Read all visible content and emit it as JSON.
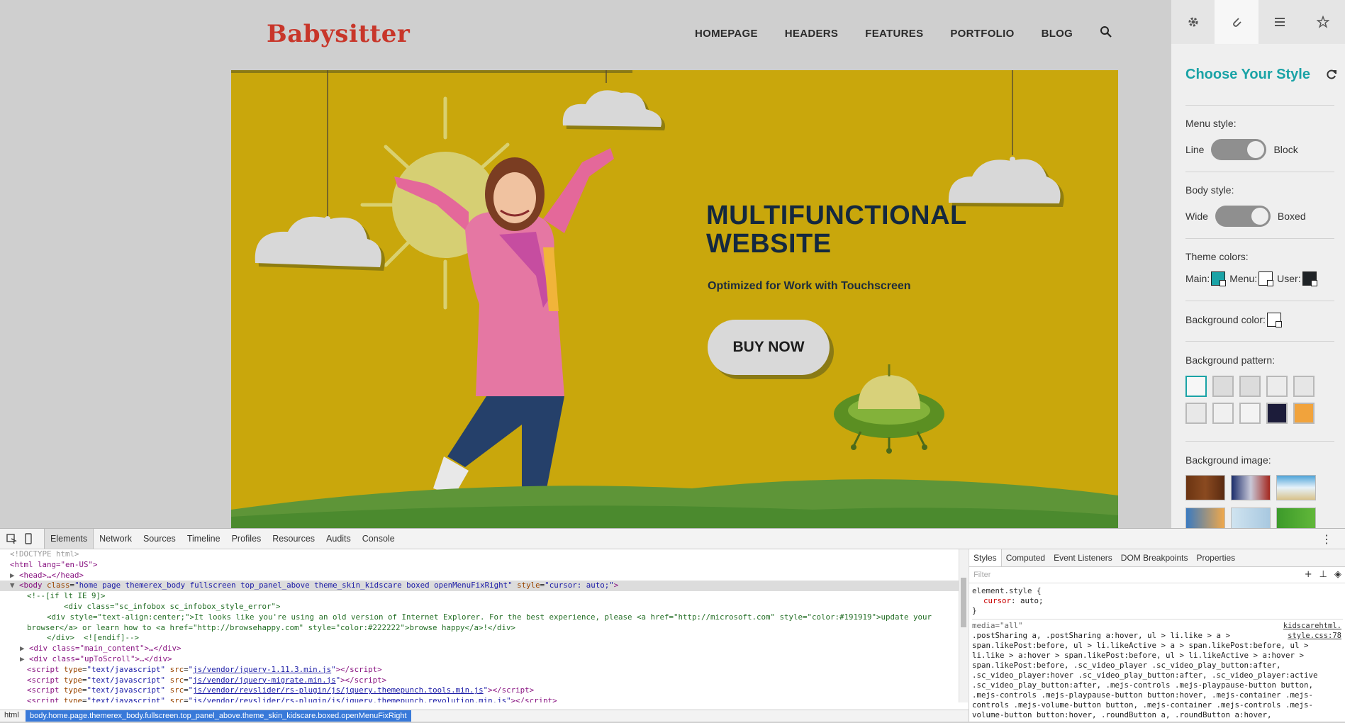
{
  "site": {
    "logo": "Babysitter",
    "nav": [
      "HOMEPAGE",
      "HEADERS",
      "FEATURES",
      "PORTFOLIO",
      "BLOG"
    ],
    "hero": {
      "title": "MULTIFUNCTIONAL WEBSITE",
      "subtitle": "Optimized for Work with Touchscreen",
      "button": "BUY NOW"
    }
  },
  "panel": {
    "title": "Choose Your Style",
    "menu_style": {
      "label": "Menu style:",
      "left": "Line",
      "right": "Block"
    },
    "body_style": {
      "label": "Body style:",
      "left": "Wide",
      "right": "Boxed"
    },
    "theme_colors": {
      "label": "Theme colors:",
      "main": "Main:",
      "menu": "Menu:",
      "user": "User:"
    },
    "background_color": "Background color:",
    "background_pattern": "Background pattern:",
    "background_image": "Background image:",
    "colors": {
      "main": "#1aa3a6",
      "menu": "#ffffff",
      "user": "#1f2326",
      "background": "#ffffff"
    }
  },
  "devtools": {
    "tabs": [
      "Elements",
      "Network",
      "Sources",
      "Timeline",
      "Profiles",
      "Resources",
      "Audits",
      "Console"
    ],
    "dom": {
      "doctype": "<!DOCTYPE html>",
      "html_open": "<html lang=\"en-US\">",
      "head": "<head>…</head>",
      "body_class": "home page themerex_body fullscreen top_panel_above theme_skin_kidscare boxed openMenuFixRight",
      "body_style": "cursor: auto;",
      "cond_open": "<!--[if lt IE 9]>",
      "div_infobox": "<div class=\"sc_infobox sc_infobox_style_error\">",
      "div_text_1": "<div style=\"text-align:center;\">It looks like you're using an old version of Internet Explorer. For the best experience, please <a href=\"http://microsoft.com\" style=\"color:#191919\">update your",
      "div_text_2": "browser</a> or learn how to <a href=\"http://browsehappy.com\" style=\"color:#222222\">browse happy</a>!</div>",
      "cond_close": "</div>  <![endif]-->",
      "main_content": "<div class=\"main_content\">…</div>",
      "up_to_scroll": "<div class=\"upToScroll\">…</div>",
      "scripts": [
        "js/vendor/jquery-1.11.3.min.js",
        "js/vendor/jquery-migrate.min.js",
        "js/vendor/revslider/rs-plugin/js/jquery.themepunch.tools.min.js",
        "js/vendor/revslider/rs-plugin/js/jquery.themepunch.revolution.min.js"
      ]
    },
    "breadcrumb": {
      "html": "html",
      "body": "body.home.page.themerex_body.fullscreen.top_panel_above.theme_skin_kidscare.boxed.openMenuFixRight"
    },
    "sidepane": {
      "tabs": [
        "Styles",
        "Computed",
        "Event Listeners",
        "DOM Breakpoints",
        "Properties"
      ],
      "filter_placeholder": "Filter",
      "element_style_selector": "element.style {",
      "element_style_prop": "cursor",
      "element_style_val": "auto;",
      "close_brace": "}",
      "media": "media=\"all\"",
      "source": "kidscarehtml.",
      "source2": "style.css:78",
      "rule_lines": [
        ".postSharing a, .postSharing a:hover, ul > li.like > a >",
        "span.likePost:before, ul > li.likeActive > a > span.likePost:before, ul >",
        "li.like > a:hover > span.likePost:before, ul > li.likeActive > a:hover >",
        "span.likePost:before, .sc_video_player .sc_video_play_button:after,",
        ".sc_video_player:hover .sc_video_play_button:after, .sc_video_player:active",
        ".sc_video_play_button:after, .mejs-controls .mejs-playpause-button button,",
        ".mejs-controls .mejs-playpause-button button:hover, .mejs-container .mejs-",
        "controls .mejs-volume-button button, .mejs-container .mejs-controls .mejs-",
        "volume-button button:hover, .roundButton a, .roundButton a:hover,"
      ]
    }
  }
}
